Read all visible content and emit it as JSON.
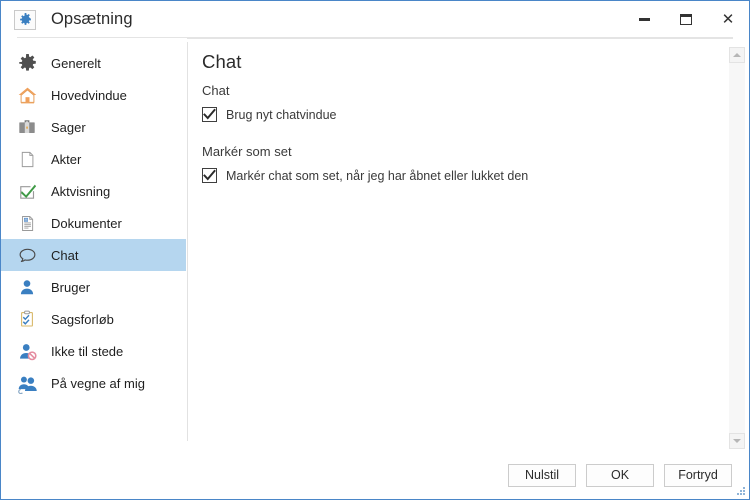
{
  "window": {
    "title": "Opsætning",
    "icon": "gear-icon",
    "border_color": "#4a86c8",
    "controls": {
      "minimize": "minimize-icon",
      "maximize": "maximize-icon",
      "close": "close-icon"
    }
  },
  "sidebar": {
    "selected_index": 6,
    "selection_color": "#b5d6ef",
    "items": [
      {
        "label": "Generelt",
        "icon": "gear-icon"
      },
      {
        "label": "Hovedvindue",
        "icon": "home-icon"
      },
      {
        "label": "Sager",
        "icon": "briefcase-icon"
      },
      {
        "label": "Akter",
        "icon": "page-icon"
      },
      {
        "label": "Aktvisning",
        "icon": "check-box-icon"
      },
      {
        "label": "Dokumenter",
        "icon": "document-icon"
      },
      {
        "label": "Chat",
        "icon": "speech-bubble-icon"
      },
      {
        "label": "Bruger",
        "icon": "person-icon"
      },
      {
        "label": "Sagsforløb",
        "icon": "clipboard-check-icon"
      },
      {
        "label": "Ikke til stede",
        "icon": "person-blocked-icon"
      },
      {
        "label": "På vegne af mig",
        "icon": "people-icon"
      }
    ]
  },
  "content": {
    "title": "Chat",
    "groups": [
      {
        "label": "Chat",
        "checkboxes": [
          {
            "label": "Brug nyt chatvindue",
            "checked": true
          }
        ]
      },
      {
        "label": "Markér som set",
        "checkboxes": [
          {
            "label": "Markér chat som set, når jeg har åbnet eller lukket den",
            "checked": true
          }
        ]
      }
    ]
  },
  "scrollbar": {
    "up_arrow": "scroll-up-icon",
    "down_arrow": "scroll-down-icon"
  },
  "footer": {
    "buttons": [
      {
        "label": "Nulstil"
      },
      {
        "label": "OK"
      },
      {
        "label": "Fortryd"
      }
    ]
  }
}
